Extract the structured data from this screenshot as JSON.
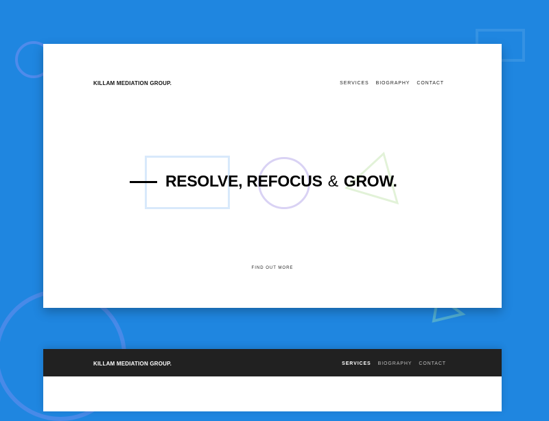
{
  "hero": {
    "brand": "KILLAM MEDIATION GROUP.",
    "nav": {
      "services": "SERVICES",
      "biography": "BIOGRAPHY",
      "contact": "CONTACT"
    },
    "headline_part1": "RESOLVE, REFOCUS",
    "headline_amp": "&",
    "headline_part2": "GROW.",
    "cta": "FIND OUT MORE"
  },
  "sticky_header": {
    "brand": "KILLAM MEDIATION GROUP.",
    "nav": {
      "services": "SERVICES",
      "biography": "BIOGRAPHY",
      "contact": "CONTACT"
    },
    "active_item": "SERVICES"
  },
  "colors": {
    "background": "#1f86e0",
    "card": "#ffffff",
    "dark_nav": "#212121",
    "square_accent": "#d8e9fb",
    "circle_accent": "#d9d2f4",
    "triangle_accent": "#e2f2d8"
  }
}
